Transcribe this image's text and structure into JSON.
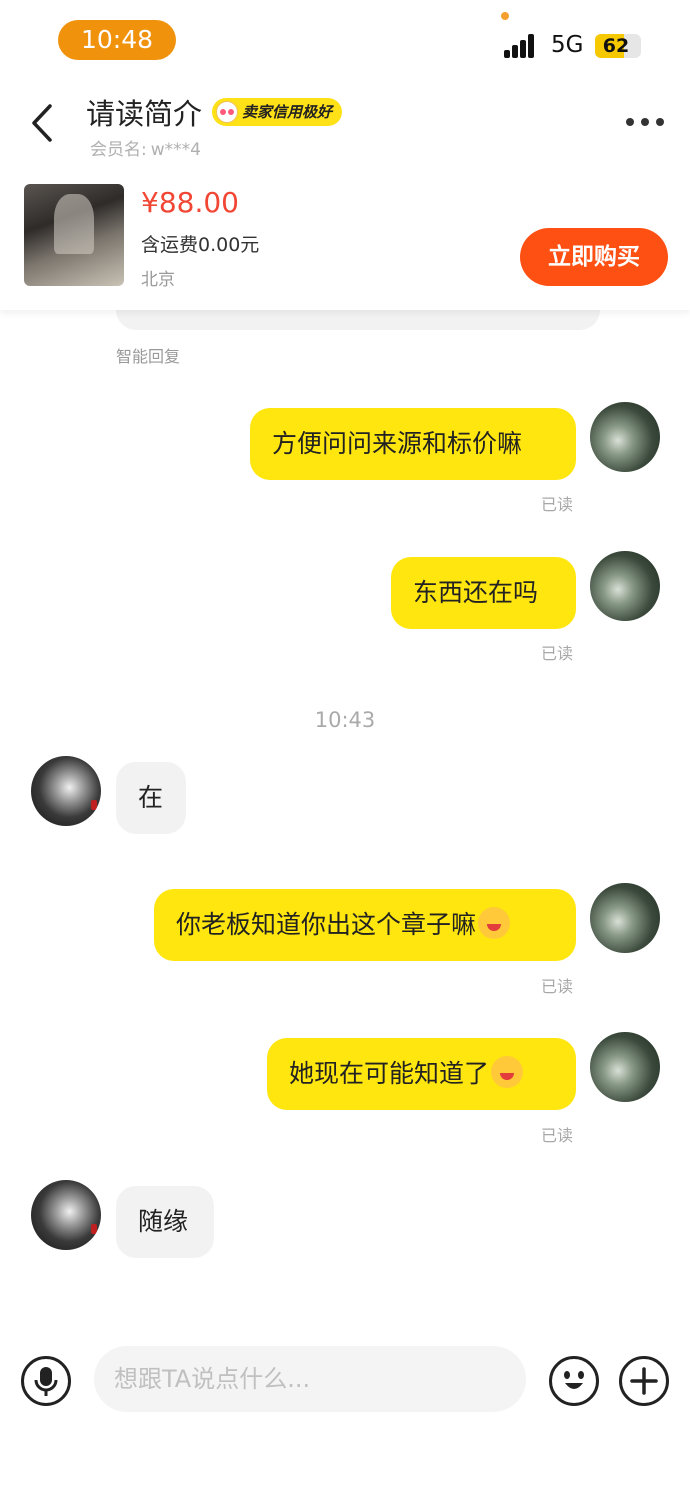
{
  "status_bar": {
    "time": "10:48",
    "network": "5G",
    "battery_level": "62",
    "battery_fraction": 0.62,
    "accent_color": "#f0920c"
  },
  "header": {
    "title": "请读简介",
    "seller_badge": "卖家信用极好",
    "member_label": "会员名:",
    "member_name": "w***4"
  },
  "product": {
    "price": "¥88.00",
    "shipping": "含运费0.00元",
    "location": "北京",
    "buy_label": "立即购买",
    "buy_color": "#ff5014"
  },
  "chat": {
    "smart_reply_label": "智能回复",
    "time_separator": "10:43",
    "read_label": "已读",
    "messages": [
      {
        "from": "me",
        "text": "方便问问来源和标价嘛",
        "status": "已读"
      },
      {
        "from": "me",
        "text": "东西还在吗",
        "status": "已读"
      },
      {
        "from": "seller",
        "text": "在"
      },
      {
        "from": "me",
        "text": "你老板知道你出这个章子嘛",
        "emoji": "grinning-squint-emoji",
        "status": "已读"
      },
      {
        "from": "me",
        "text": "她现在可能知道了",
        "emoji": "hugging-emoji",
        "status": "已读"
      },
      {
        "from": "seller",
        "text": "随缘"
      }
    ],
    "my_bubble_color": "#ffe60f",
    "their_bubble_color": "#f2f2f2"
  },
  "input_bar": {
    "placeholder": "想跟TA说点什么...",
    "value": ""
  }
}
